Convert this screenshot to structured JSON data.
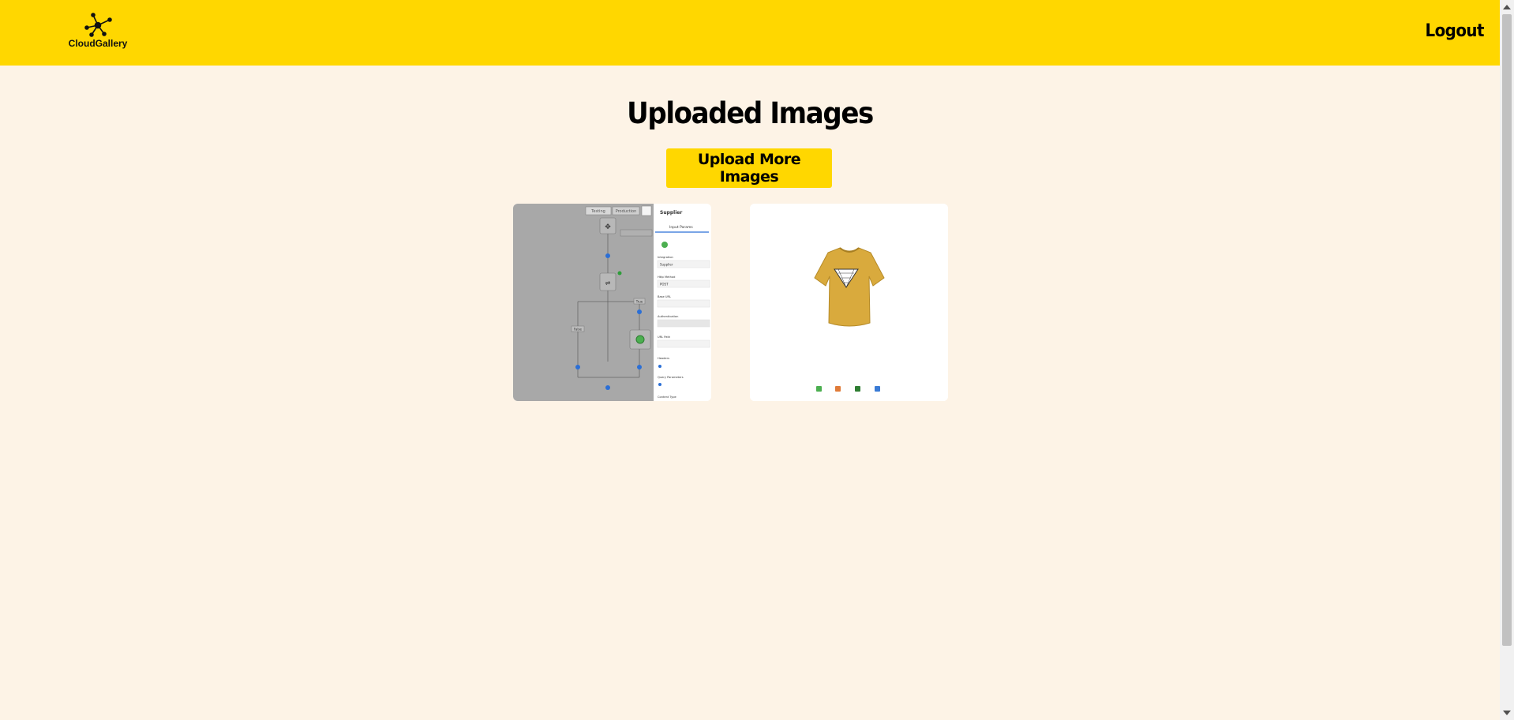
{
  "header": {
    "brand": "CloudGallery",
    "logout_label": "Logout",
    "bg_color": "#ffd700"
  },
  "main": {
    "title": "Uploaded Images",
    "upload_button_label": "Upload More Images"
  },
  "gallery": {
    "images": [
      {
        "name": "workflow-screenshot",
        "panel_title": "Supplier",
        "canvas_tabs": [
          "Testing",
          "Production"
        ],
        "panel_tab": "Input Params",
        "fields": [
          "Integration",
          "Supplier",
          "Http Method",
          "POST",
          "Base URL",
          "Authentication",
          "URL Path",
          "Headers",
          "Query Parameters",
          "Content Type"
        ],
        "branch_labels": [
          "False",
          "True"
        ]
      },
      {
        "name": "tshirt-product-photo",
        "shirt_color": "#d9aa3d"
      }
    ]
  }
}
